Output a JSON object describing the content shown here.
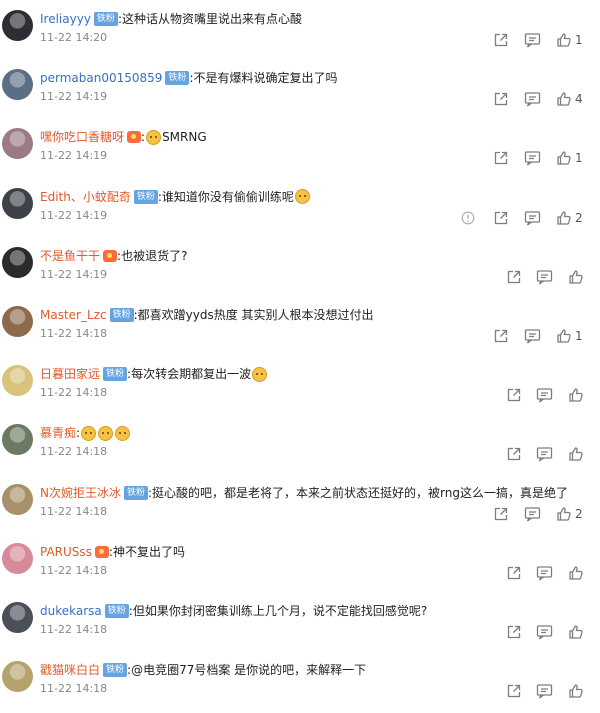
{
  "comments": [
    {
      "user": "Ireliayyy",
      "user_color": "#3a6fc2",
      "badge": "铁粉",
      "vip": false,
      "text": "这种话从物资嘴里说出来有点心酸",
      "emojis": 0,
      "time": "11-22 14:20",
      "likes": "1",
      "avatar_color": "#2d2d33",
      "has_report": false
    },
    {
      "user": "permaban00150859",
      "user_color": "#3a6fc2",
      "badge": "铁粉",
      "vip": false,
      "text": "不是有爆料说确定复出了吗",
      "emojis": 0,
      "time": "11-22 14:19",
      "likes": "4",
      "avatar_color": "#5a6e84",
      "has_report": false
    },
    {
      "user": "嘿你吃口香糖呀",
      "user_color": "#e05a2b",
      "badge": "",
      "vip": true,
      "text": "SMRNG",
      "emojis": 1,
      "time": "11-22 14:19",
      "likes": "1",
      "avatar_color": "#9c7a84",
      "has_report": false
    },
    {
      "user": "Edith、小蚊配奇",
      "user_color": "#e05a2b",
      "badge": "铁粉",
      "vip": false,
      "text": "谁知道你没有偷偷训练呢",
      "emojis": 1,
      "time": "11-22 14:19",
      "likes": "2",
      "avatar_color": "#3c4248",
      "has_report": true
    },
    {
      "user": "不是鱼干干",
      "user_color": "#e05a2b",
      "badge": "",
      "vip": true,
      "text": "也被退货了?",
      "emojis": 0,
      "time": "11-22 14:19",
      "likes": "",
      "avatar_color": "#2b2b2b",
      "has_report": false
    },
    {
      "user": "Master_Lzc",
      "user_color": "#e05a2b",
      "badge": "铁粉",
      "vip": false,
      "text": "都喜欢蹭yyds热度 其实别人根本没想过付出",
      "emojis": 0,
      "time": "11-22 14:18",
      "likes": "1",
      "avatar_color": "#8d6a4c",
      "has_report": false
    },
    {
      "user": "日暮田家远",
      "user_color": "#e05a2b",
      "badge": "铁粉",
      "vip": false,
      "text": "每次转会期都复出一波",
      "emojis": 1,
      "time": "11-22 14:18",
      "likes": "",
      "avatar_color": "#d9c27a",
      "has_report": false
    },
    {
      "user": "慕青痴",
      "user_color": "#e05a2b",
      "badge": "",
      "vip": false,
      "text": "",
      "emojis": 3,
      "time": "11-22 14:18",
      "likes": "",
      "avatar_color": "#6d7a63",
      "has_report": false
    },
    {
      "user": "N次婉拒王冰冰",
      "user_color": "#e05a2b",
      "badge": "铁粉",
      "vip": false,
      "text": "挺心酸的吧，都是老将了，本来之前状态还挺好的，被rng这么一搞，真是绝了",
      "emojis": 0,
      "time": "11-22 14:18",
      "likes": "2",
      "avatar_color": "#a7916a",
      "has_report": false
    },
    {
      "user": "PARUSss",
      "user_color": "#e05a2b",
      "badge": "",
      "vip": true,
      "text": "神不复出了吗",
      "emojis": 0,
      "time": "11-22 14:18",
      "likes": "",
      "avatar_color": "#d88a9a",
      "has_report": false
    },
    {
      "user": "dukekarsa",
      "user_color": "#3a6fc2",
      "badge": "铁粉",
      "vip": false,
      "text": "但如果你封闭密集训练上几个月，说不定能找回感觉呢?",
      "emojis": 0,
      "time": "11-22 14:18",
      "likes": "",
      "avatar_color": "#4a4f58",
      "has_report": false
    },
    {
      "user": "戳猫咪白白",
      "user_color": "#e05a2b",
      "badge": "铁粉",
      "vip": false,
      "text": "@电竞圈77号档案 是你说的吧，来解释一下",
      "emojis": 0,
      "time": "11-22 14:18",
      "likes": "",
      "avatar_color": "#b5a36c",
      "has_report": false
    }
  ],
  "colors": {
    "badge": "#66a3e3",
    "vip": "#ff6b3a",
    "icon": "#7d7d7d",
    "time": "#888888"
  },
  "icons": {
    "share": "share-icon",
    "comment": "comment-icon",
    "like": "like-icon",
    "report": "report-icon"
  }
}
